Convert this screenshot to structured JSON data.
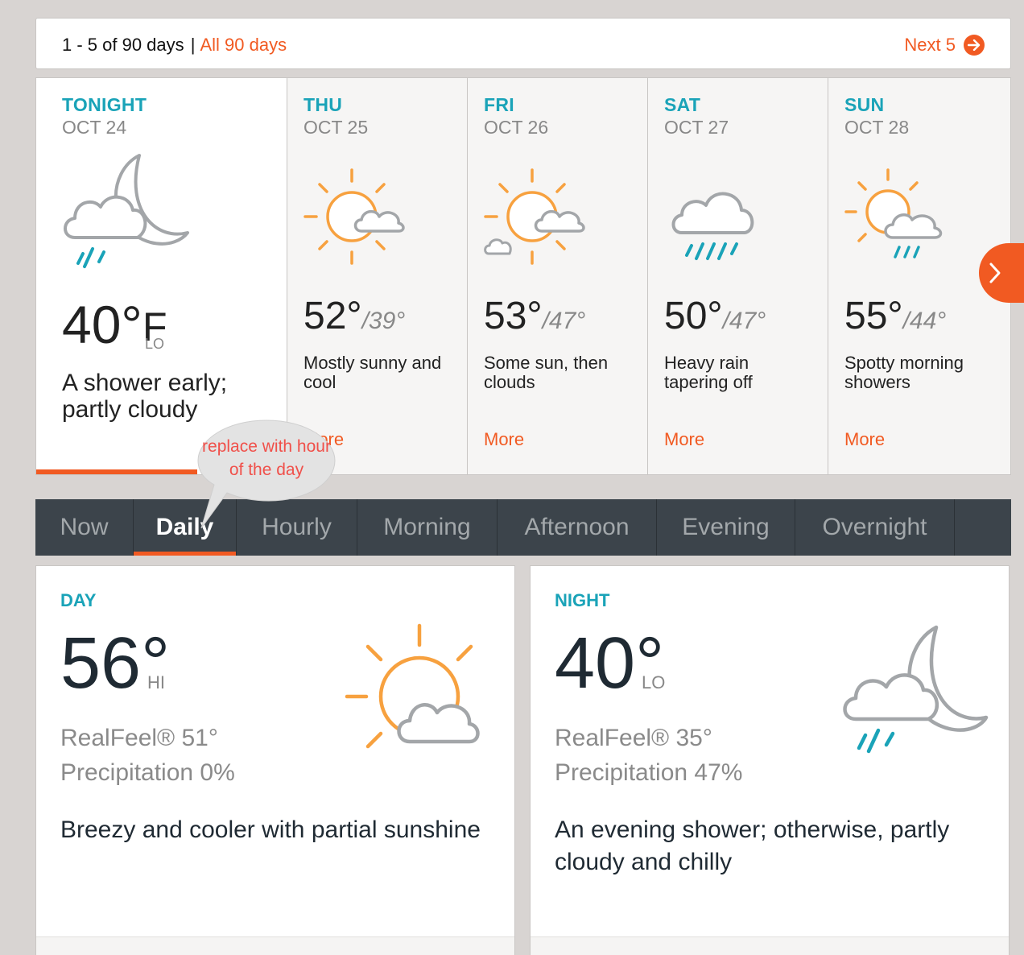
{
  "pager": {
    "range": "1 - 5 of 90 days",
    "separator": "|",
    "all": "All 90 days",
    "next": "Next 5"
  },
  "tonight": {
    "name": "TONIGHT",
    "date": "OCT 24",
    "temp": "40°",
    "unit": "F",
    "lo": "LO",
    "desc": "A shower early; partly cloudy",
    "icon": "moon-cloud-rain-icon"
  },
  "days": [
    {
      "name": "THU",
      "date": "OCT 25",
      "hi": "52°",
      "lo": "/39°",
      "desc": "Mostly sunny and cool",
      "more": "More",
      "icon": "sun-cloud-icon"
    },
    {
      "name": "FRI",
      "date": "OCT 26",
      "hi": "53°",
      "lo": "/47°",
      "desc": "Some sun, then clouds",
      "more": "More",
      "icon": "sun-clouds-icon"
    },
    {
      "name": "SAT",
      "date": "OCT 27",
      "hi": "50°",
      "lo": "/47°",
      "desc": "Heavy rain tapering off",
      "more": "More",
      "icon": "cloud-heavy-rain-icon"
    },
    {
      "name": "SUN",
      "date": "OCT 28",
      "hi": "55°",
      "lo": "/44°",
      "desc": "Spotty morning showers",
      "more": "More",
      "icon": "sun-cloud-rain-icon"
    }
  ],
  "annotation": {
    "text": "replace with hour of the day"
  },
  "tabs": [
    "Now",
    "Daily",
    "Hourly",
    "Morning",
    "Afternoon",
    "Evening",
    "Overnight"
  ],
  "active_tab": "Daily",
  "day_card": {
    "label": "DAY",
    "temp": "56°",
    "hilo": "HI",
    "realfeel": "RealFeel® 51°",
    "precip": "Precipitation 0%",
    "desc": "Breezy and cooler with partial sunshine",
    "icon": "sun-cloud-icon"
  },
  "night_card": {
    "label": "NIGHT",
    "temp": "40°",
    "hilo": "LO",
    "realfeel": "RealFeel® 35°",
    "precip": "Precipitation 47%",
    "desc": "An evening shower; otherwise, partly cloudy and chilly",
    "icon": "moon-cloud-rain-icon"
  },
  "colors": {
    "accent": "#f15a22",
    "teal": "#1aa3b8",
    "sun": "#f7a13f",
    "cloud": "#a3a6a9",
    "tabbar": "#3c444b"
  }
}
